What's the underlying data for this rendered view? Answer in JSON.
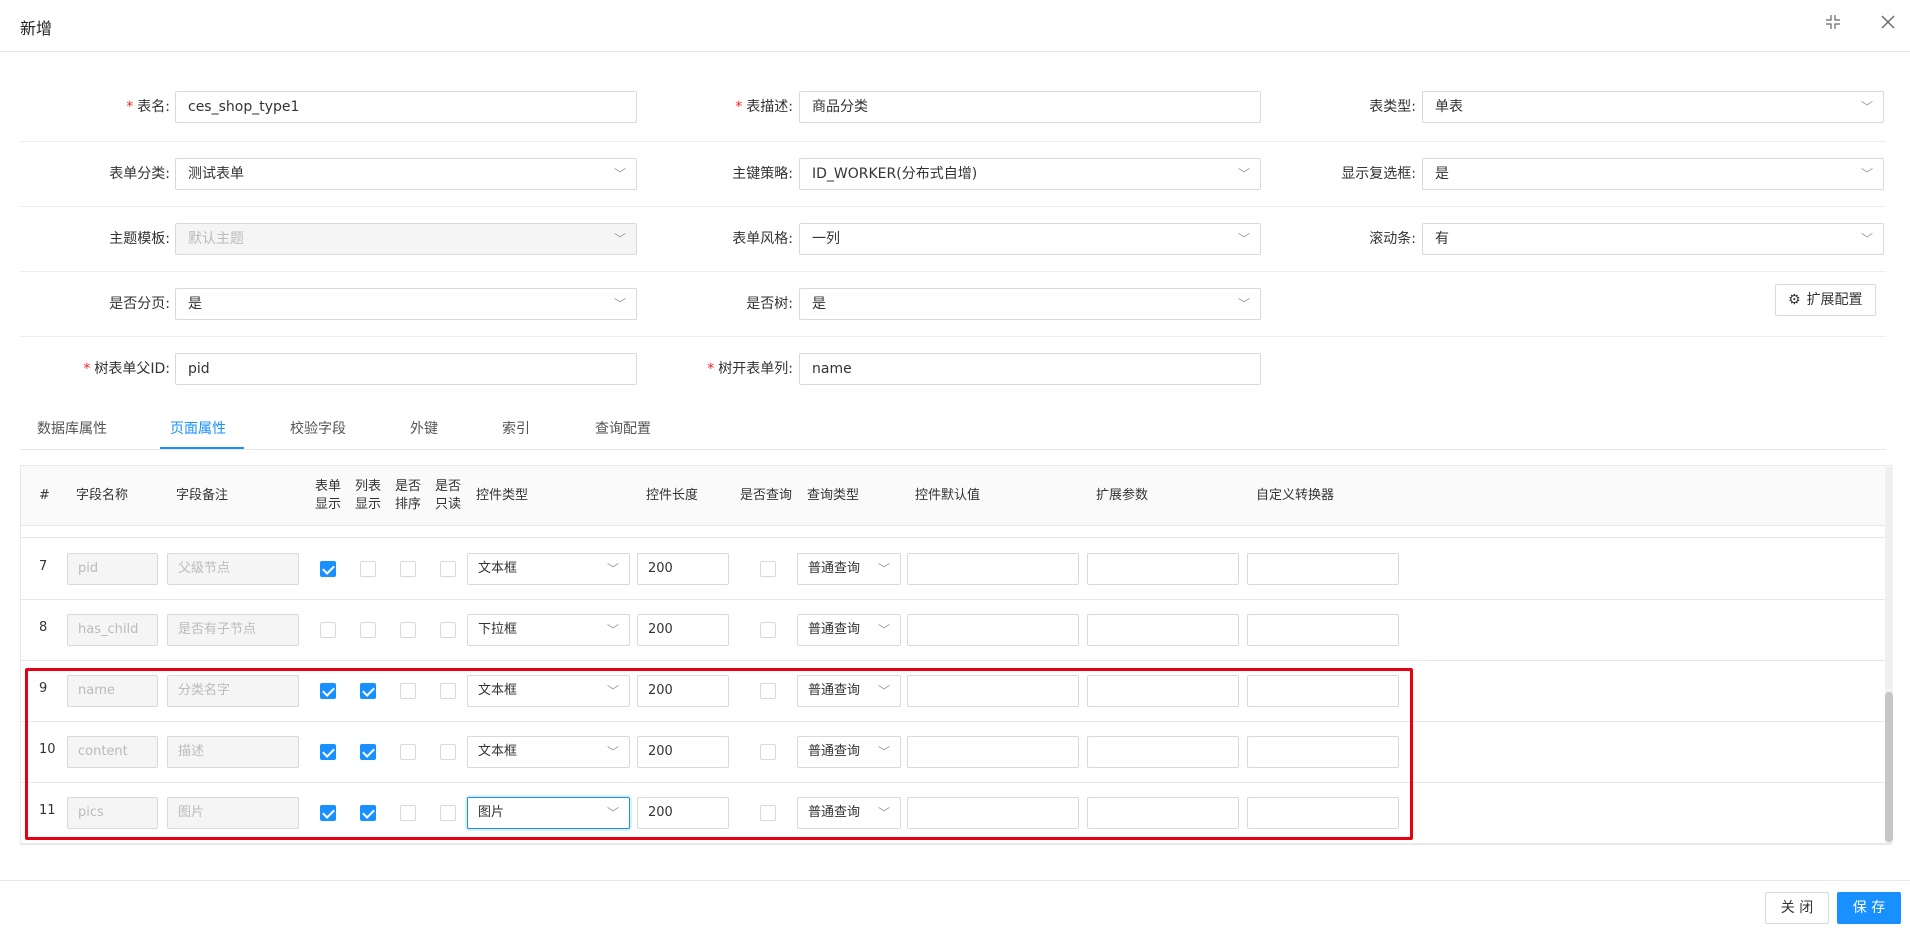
{
  "header": {
    "title": "新增",
    "expand_icon": "compress-icon",
    "close_icon": "close-icon"
  },
  "form": {
    "table_name": {
      "label": "表名:",
      "value": "ces_shop_type1",
      "required": true
    },
    "table_desc": {
      "label": "表描述:",
      "value": "商品分类",
      "required": true
    },
    "table_type": {
      "label": "表类型:",
      "value": "单表"
    },
    "form_category": {
      "label": "表单分类:",
      "value": "测试表单"
    },
    "pk_strategy": {
      "label": "主键策略:",
      "value": "ID_WORKER(分布式自增)"
    },
    "show_checkbox": {
      "label": "显示复选框:",
      "value": "是"
    },
    "theme": {
      "label": "主题模板:",
      "value": "默认主题"
    },
    "form_style": {
      "label": "表单风格:",
      "value": "一列"
    },
    "scrollbar": {
      "label": "滚动条:",
      "value": "有"
    },
    "pagination": {
      "label": "是否分页:",
      "value": "是"
    },
    "is_tree": {
      "label": "是否树:",
      "value": "是"
    },
    "ext_config_label": "扩展配置",
    "tree_parent": {
      "label": "树表单父ID:",
      "value": "pid",
      "required": true
    },
    "tree_open_col": {
      "label": "树开表单列:",
      "value": "name",
      "required": true
    }
  },
  "tabs": [
    {
      "label": "数据库属性"
    },
    {
      "label": "页面属性"
    },
    {
      "label": "校验字段"
    },
    {
      "label": "外键"
    },
    {
      "label": "索引"
    },
    {
      "label": "查询配置"
    }
  ],
  "active_tab": "页面属性",
  "table": {
    "headers": {
      "num": "#",
      "field_name": "字段名称",
      "field_note": "字段备注",
      "form_show_1": "表单",
      "form_show_2": "显示",
      "list_show_1": "列表",
      "list_show_2": "显示",
      "sort_1": "是否",
      "sort_2": "排序",
      "readonly_1": "是否",
      "readonly_2": "只读",
      "control_type": "控件类型",
      "control_length": "控件长度",
      "is_query": "是否查询",
      "query_type": "查询类型",
      "default_value": "控件默认值",
      "ext_params": "扩展参数",
      "converter": "自定义转换器"
    },
    "rows": [
      {
        "num": "7",
        "name": "pid",
        "note": "父级节点",
        "form_show": true,
        "list_show": false,
        "sort": false,
        "readonly": false,
        "control": "文本框",
        "length": "200",
        "query": false,
        "query_type": "普通查询"
      },
      {
        "num": "8",
        "name": "has_child",
        "note": "是否有子节点",
        "form_show": false,
        "list_show": false,
        "sort": false,
        "readonly": false,
        "control": "下拉框",
        "length": "200",
        "query": false,
        "query_type": "普通查询"
      },
      {
        "num": "9",
        "name": "name",
        "note": "分类名字",
        "form_show": true,
        "list_show": true,
        "sort": false,
        "readonly": false,
        "control": "文本框",
        "length": "200",
        "query": false,
        "query_type": "普通查询"
      },
      {
        "num": "10",
        "name": "content",
        "note": "描述",
        "form_show": true,
        "list_show": true,
        "sort": false,
        "readonly": false,
        "control": "文本框",
        "length": "200",
        "query": false,
        "query_type": "普通查询"
      },
      {
        "num": "11",
        "name": "pics",
        "note": "图片",
        "form_show": true,
        "list_show": true,
        "sort": false,
        "readonly": false,
        "control": "图片",
        "length": "200",
        "query": false,
        "query_type": "普通查询"
      }
    ]
  },
  "footer": {
    "close_label": "关 闭",
    "save_label": "保 存"
  },
  "colors": {
    "primary": "#1890ff",
    "required": "#f5222d",
    "highlight": "#e60012"
  }
}
